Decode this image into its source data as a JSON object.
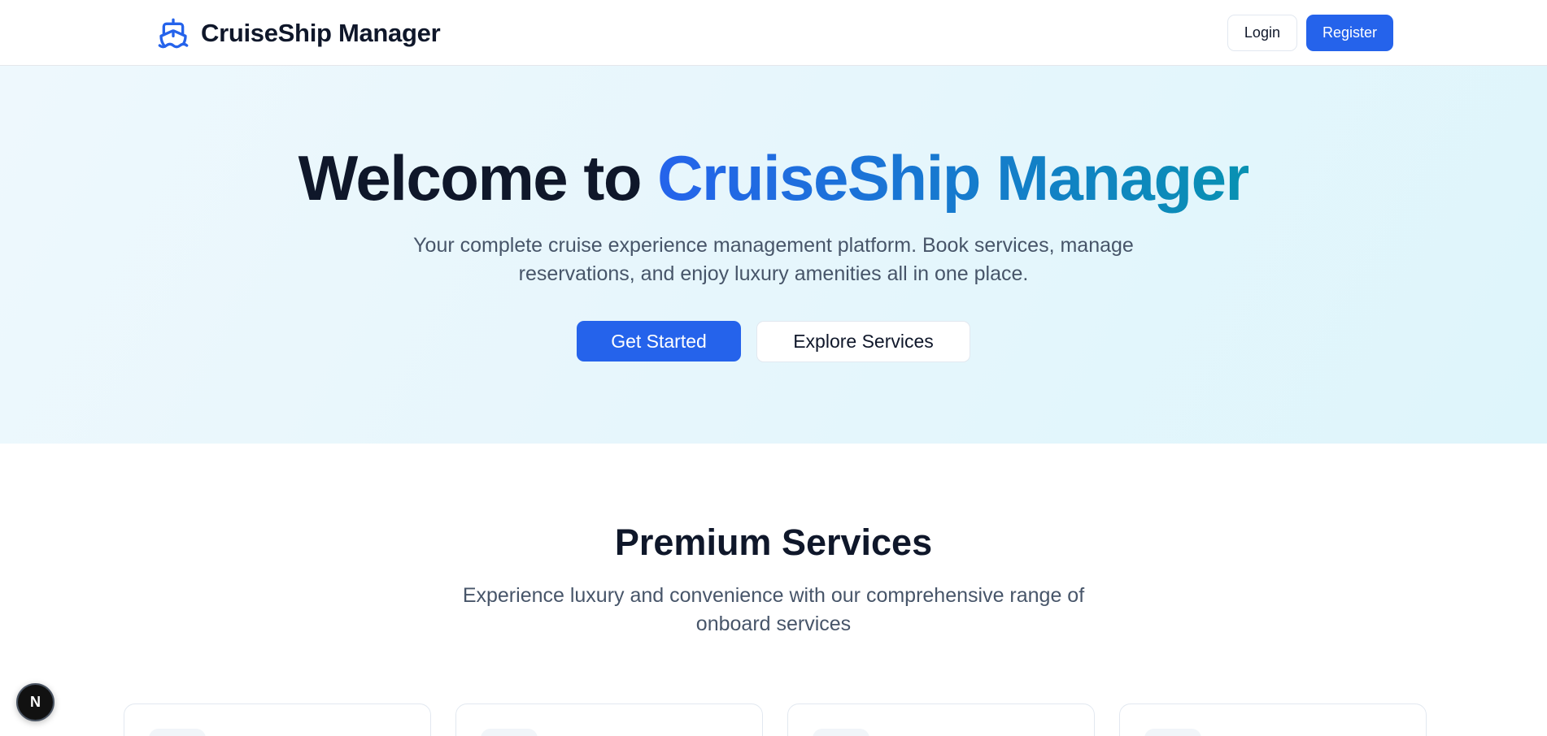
{
  "header": {
    "brand_name": "CruiseShip Manager",
    "login_label": "Login",
    "register_label": "Register"
  },
  "hero": {
    "title_plain": "Welcome to",
    "title_accent": "CruiseShip Manager",
    "subtitle": "Your complete cruise experience management platform. Book services, manage reservations, and enjoy luxury amenities all in one place.",
    "primary_cta": "Get Started",
    "secondary_cta": "Explore Services"
  },
  "services": {
    "title": "Premium Services",
    "subtitle": "Experience luxury and convenience with our comprehensive range of onboard services"
  },
  "dev_badge": {
    "label": "N"
  },
  "colors": {
    "primary": "#2563eb",
    "accent_end": "#0891b2",
    "text_dark": "#0f172a",
    "text_muted": "#475569"
  },
  "icons": {
    "brand": "ship-icon",
    "dev_badge": "nextjs-icon"
  }
}
